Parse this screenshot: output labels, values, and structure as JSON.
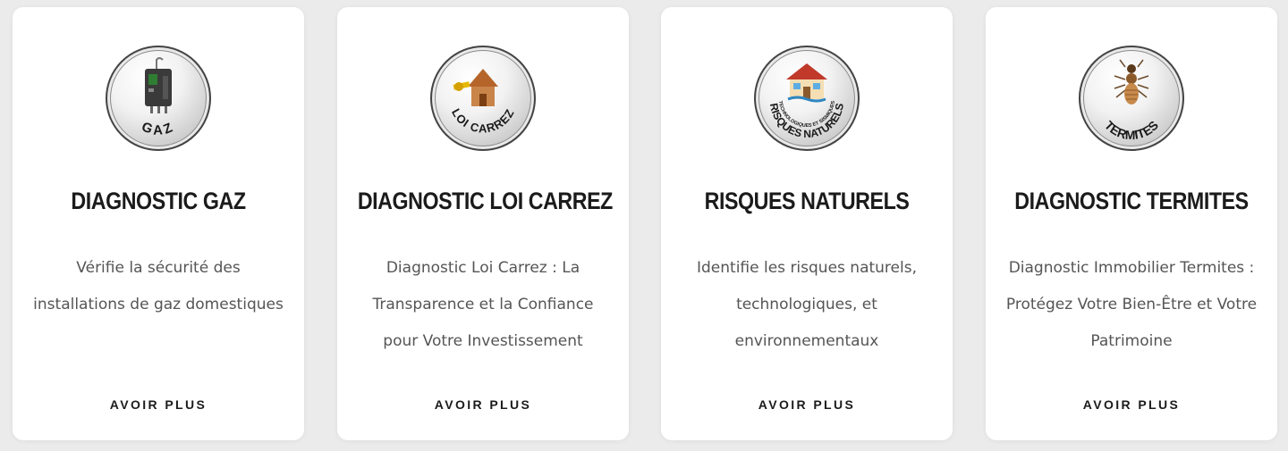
{
  "cards": [
    {
      "title": "DIAGNOSTIC GAZ",
      "description": "Vérifie la sécurité des installations de gaz domestiques",
      "link_label": "AVOIR PLUS",
      "badge_label": "GAZ",
      "icon": "gas-boiler-icon"
    },
    {
      "title": "DIAGNOSTIC LOI CARREZ",
      "description": "Diagnostic Loi Carrez : La Transparence et la Confiance pour Votre Investissement",
      "link_label": "AVOIR PLUS",
      "badge_label": "LOI CARREZ",
      "icon": "house-measure-icon"
    },
    {
      "title": "RISQUES NATURELS",
      "description": "Identifie les risques naturels, technologiques, et environnementaux",
      "link_label": "AVOIR PLUS",
      "badge_label": "RISQUES NATURELS",
      "badge_sublabel": "TECHNOLOGIQUES ET SISMIQUES",
      "icon": "house-flood-icon"
    },
    {
      "title": "DIAGNOSTIC TERMITES",
      "description": "Diagnostic Immobilier Termites : Protégez Votre Bien-Être et Votre Patrimoine",
      "link_label": "AVOIR PLUS",
      "badge_label": "TERMITES",
      "icon": "termite-icon"
    }
  ],
  "colors": {
    "background": "#ebebeb",
    "card": "#ffffff",
    "title": "#1b1b1b",
    "text": "#555555"
  }
}
